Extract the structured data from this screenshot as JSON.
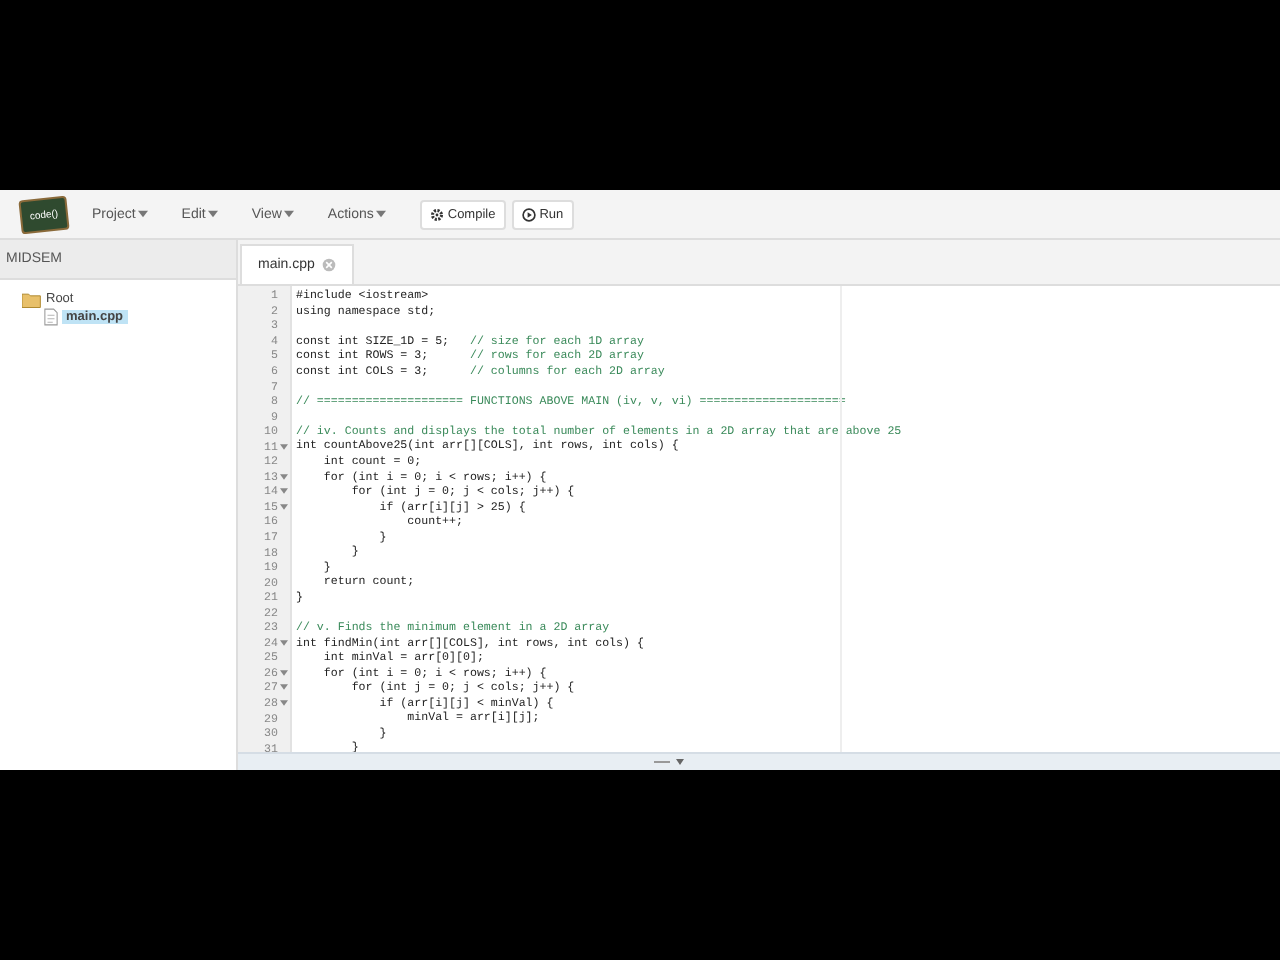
{
  "logo": {
    "text": "code()"
  },
  "menus": [
    {
      "label": "Project"
    },
    {
      "label": "Edit"
    },
    {
      "label": "View"
    },
    {
      "label": "Actions"
    }
  ],
  "buttons": [
    {
      "label": "Compile",
      "kind": "compile"
    },
    {
      "label": "Run",
      "kind": "run"
    }
  ],
  "sidebar": {
    "title": "MIDSEM",
    "tree": [
      {
        "label": "Root",
        "kind": "folder",
        "children": [
          {
            "label": "main.cpp",
            "kind": "file",
            "selected": true
          }
        ]
      }
    ]
  },
  "tabs": [
    {
      "label": "main.cpp",
      "selected": true
    }
  ],
  "editor": {
    "lines": [
      {
        "n": "1",
        "code": "#include <iostream>",
        "fold": false
      },
      {
        "n": "2",
        "code": "using namespace std;",
        "fold": false
      },
      {
        "n": "3",
        "fold": false
      },
      {
        "n": "4",
        "code": "const int SIZE_1D = 5;   ",
        "comment": "// size for each 1D array",
        "fold": false
      },
      {
        "n": "5",
        "code": "const int ROWS = 3;      ",
        "comment": "// rows for each 2D array",
        "fold": false
      },
      {
        "n": "6",
        "code": "const int COLS = 3;      ",
        "comment": "// columns for each 2D array",
        "fold": false
      },
      {
        "n": "7",
        "fold": false
      },
      {
        "n": "8",
        "comment": "// ===================== FUNCTIONS ABOVE MAIN (iv, v, vi) =====================",
        "fold": false
      },
      {
        "n": "9",
        "fold": false
      },
      {
        "n": "10",
        "comment": "// iv. Counts and displays the total number of elements in a 2D array that are above 25",
        "fold": false
      },
      {
        "n": "11",
        "code": "int countAbove25(int arr[][COLS], int rows, int cols) {",
        "fold": true
      },
      {
        "n": "12",
        "code": "    int count = 0;",
        "fold": false
      },
      {
        "n": "13",
        "code": "    for (int i = 0; i < rows; i++) {",
        "fold": true
      },
      {
        "n": "14",
        "code": "        for (int j = 0; j < cols; j++) {",
        "fold": true
      },
      {
        "n": "15",
        "code": "            if (arr[i][j] > 25) {",
        "fold": true
      },
      {
        "n": "16",
        "code": "                count++;",
        "fold": false
      },
      {
        "n": "17",
        "code": "            }",
        "fold": false
      },
      {
        "n": "18",
        "code": "        }",
        "fold": false
      },
      {
        "n": "19",
        "code": "    }",
        "fold": false
      },
      {
        "n": "20",
        "code": "    return count;",
        "fold": false
      },
      {
        "n": "21",
        "code": "}",
        "fold": false
      },
      {
        "n": "22",
        "fold": false
      },
      {
        "n": "23",
        "comment": "// v. Finds the minimum element in a 2D array",
        "fold": false
      },
      {
        "n": "24",
        "code": "int findMin(int arr[][COLS], int rows, int cols) {",
        "fold": true
      },
      {
        "n": "25",
        "code": "    int minVal = arr[0][0];",
        "fold": false
      },
      {
        "n": "26",
        "code": "    for (int i = 0; i < rows; i++) {",
        "fold": true
      },
      {
        "n": "27",
        "code": "        for (int j = 0; j < cols; j++) {",
        "fold": true
      },
      {
        "n": "28",
        "code": "            if (arr[i][j] < minVal) {",
        "fold": true
      },
      {
        "n": "29",
        "code": "                minVal = arr[i][j];",
        "fold": false
      },
      {
        "n": "30",
        "code": "            }",
        "fold": false
      },
      {
        "n": "31",
        "code": "        }",
        "fold": false
      }
    ]
  }
}
